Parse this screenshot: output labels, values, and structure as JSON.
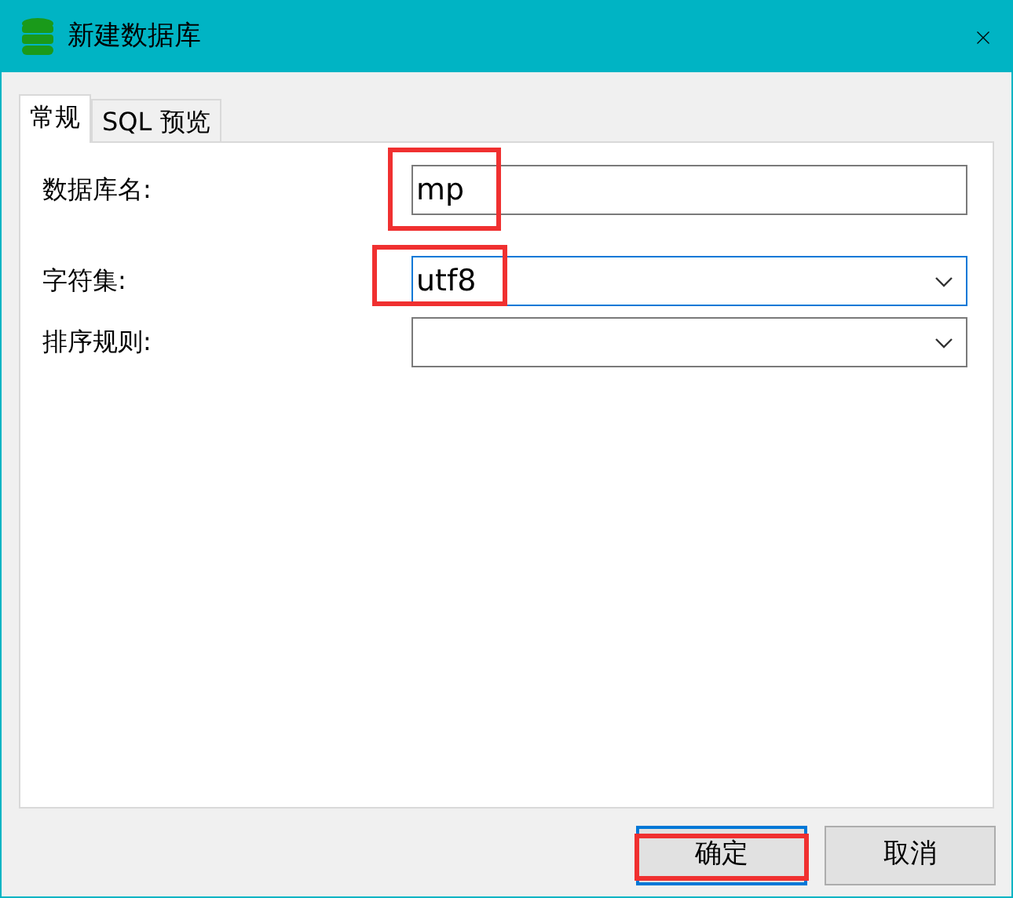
{
  "window": {
    "title": "新建数据库"
  },
  "tabs": [
    {
      "label": "常规",
      "selected": true
    },
    {
      "label": "SQL 预览",
      "selected": false
    }
  ],
  "fields": [
    {
      "kind": "text",
      "label": "数据库名:",
      "value": "mp",
      "focused": false,
      "highlighted": true
    },
    {
      "kind": "dropdown",
      "label": "字符集:",
      "value": "utf8",
      "focused": true,
      "highlighted": true
    },
    {
      "kind": "dropdown",
      "label": "排序规则:",
      "focused": false,
      "highlighted": false
    }
  ],
  "buttons": [
    {
      "label": "确定",
      "default": true,
      "highlighted": true
    },
    {
      "label": "取消",
      "default": false,
      "highlighted": false
    }
  ]
}
